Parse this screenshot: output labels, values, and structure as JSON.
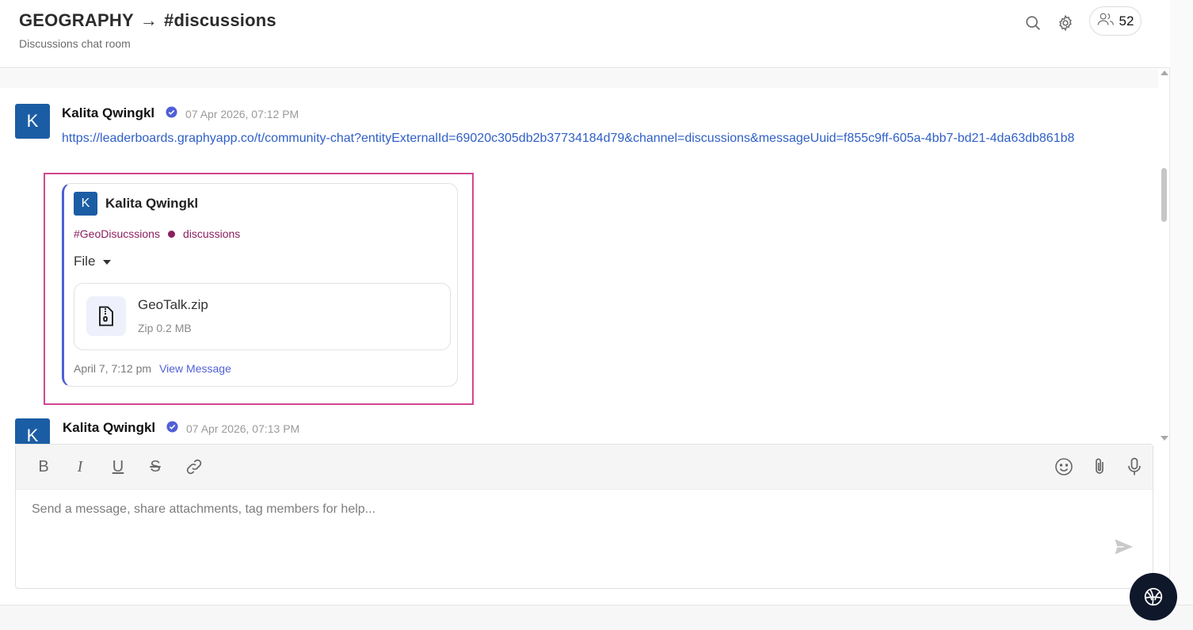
{
  "header": {
    "community": "GEOGRAPHY",
    "arrow": "→",
    "channel": "#discussions",
    "subtitle": "Discussions chat room",
    "member_count": "52"
  },
  "messages": [
    {
      "avatar_letter": "K",
      "author": "Kalita Qwingkl",
      "timestamp": "07 Apr 2026, 07:12 PM",
      "link": "https://leaderboards.graphyapp.co/t/community-chat?entityExternalId=69020c305db2b37734184d79&channel=discussions&messageUuid=f855c9ff-605a-4bb7-bd21-4da63db861b8",
      "preview": {
        "avatar_letter": "K",
        "author": "Kalita Qwingkl",
        "tag": "#GeoDisucssions",
        "channel": "discussions",
        "section_label": "File",
        "file": {
          "name": "GeoTalk.zip",
          "meta": "Zip 0.2 MB"
        },
        "date": "April 7, 7:12 pm",
        "view_label": "View Message"
      }
    },
    {
      "avatar_letter": "K",
      "author": "Kalita Qwingkl",
      "timestamp": "07 Apr 2026, 07:13 PM"
    }
  ],
  "composer": {
    "bold": "B",
    "italic": "I",
    "underline": "U",
    "strike": "S",
    "placeholder": "Send a message, share attachments, tag members for help..."
  },
  "colors": {
    "avatar_bg": "#1b5da4",
    "link": "#2f5fc6",
    "accent": "#4f5fd6",
    "tag": "#8a1e5e",
    "highlight": "#d1478f",
    "fab_bg": "#0f172a"
  },
  "icons": {
    "search": "search-icon",
    "settings": "gear-icon",
    "members": "users-icon",
    "verified": "verified-badge-icon",
    "file": "zip-file-icon",
    "link": "link-icon",
    "emoji": "emoji-icon",
    "attach": "paperclip-icon",
    "mic": "microphone-icon",
    "send": "send-icon",
    "fab": "globe-icon"
  }
}
